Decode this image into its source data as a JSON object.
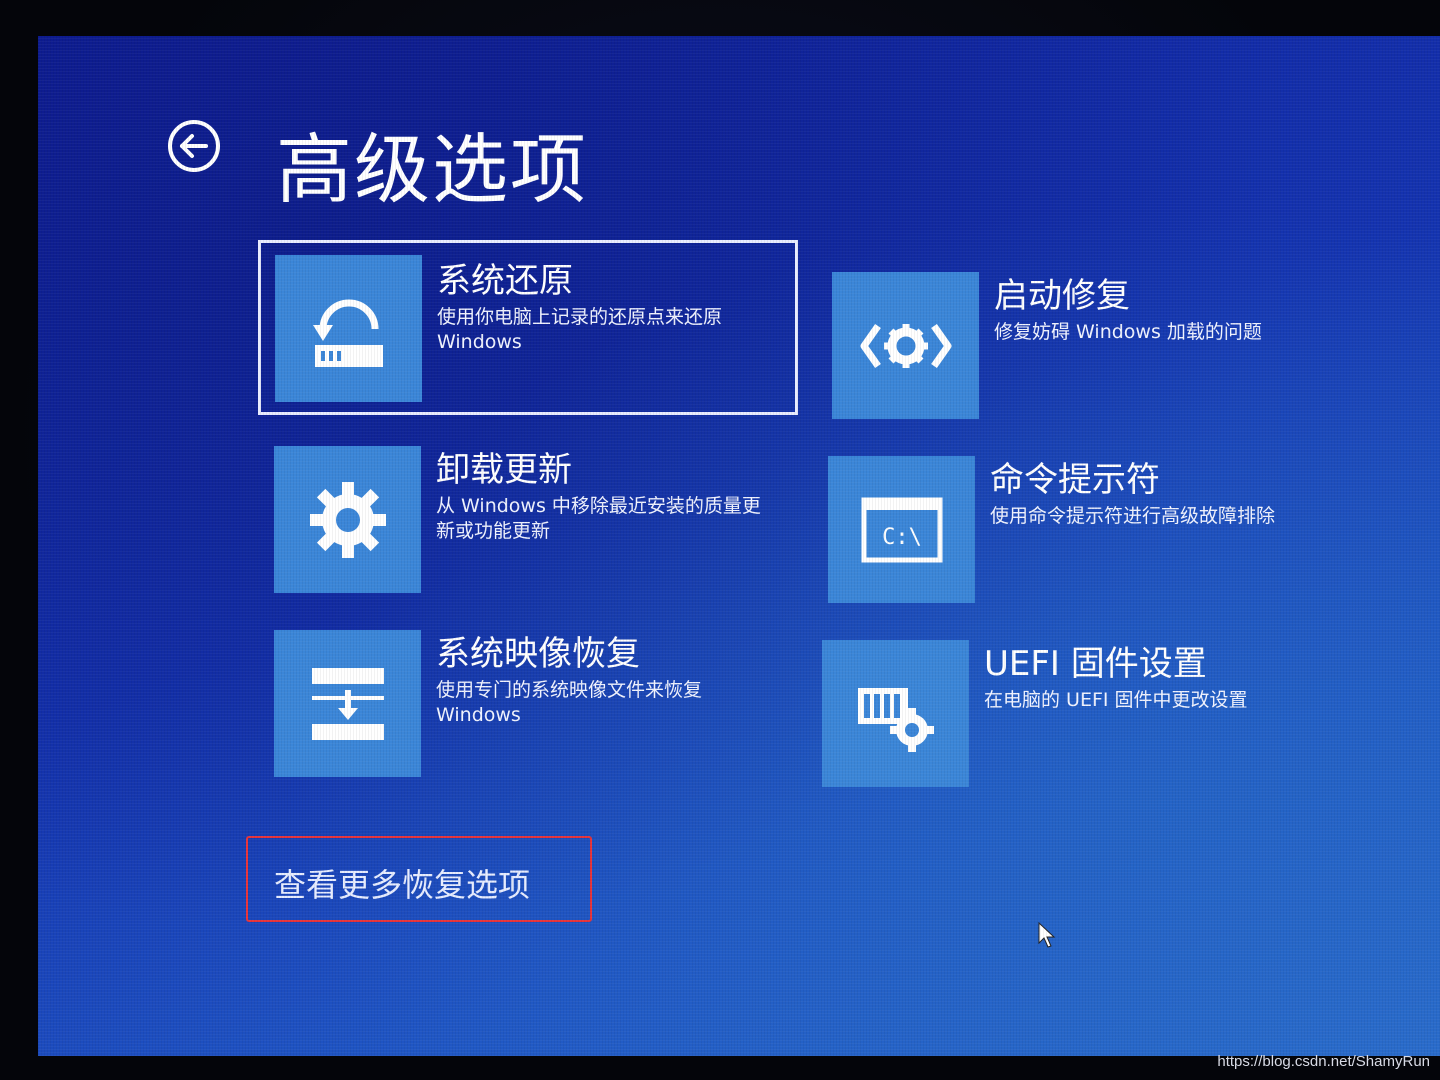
{
  "header": {
    "title": "高级选项",
    "back_icon": "back-arrow-icon"
  },
  "options": [
    {
      "title": "系统还原",
      "description": "使用你电脑上记录的还原点来还原 Windows",
      "icon": "system-restore-icon",
      "selected": true
    },
    {
      "title": "启动修复",
      "description": "修复妨碍 Windows 加载的问题",
      "icon": "startup-repair-icon",
      "selected": false
    },
    {
      "title": "卸载更新",
      "description": "从 Windows 中移除最近安装的质量更新或功能更新",
      "icon": "gear-icon",
      "selected": false
    },
    {
      "title": "命令提示符",
      "description": "使用命令提示符进行高级故障排除",
      "icon": "command-prompt-icon",
      "icon_text": "C:\\",
      "selected": false
    },
    {
      "title": "系统映像恢复",
      "description": "使用专门的系统映像文件来恢复 Windows",
      "icon": "system-image-recovery-icon",
      "selected": false
    },
    {
      "title": "UEFI 固件设置",
      "description": "在电脑的 UEFI 固件中更改设置",
      "icon": "uefi-firmware-icon",
      "selected": false
    }
  ],
  "more_options_link": "查看更多恢复选项",
  "watermark": "https://blog.csdn.net/ShamyRun",
  "colors": {
    "background": "#1433b0",
    "tile_icon_bg": "#3b86d8",
    "highlight_border": "#e8333a",
    "text": "#ffffff"
  }
}
